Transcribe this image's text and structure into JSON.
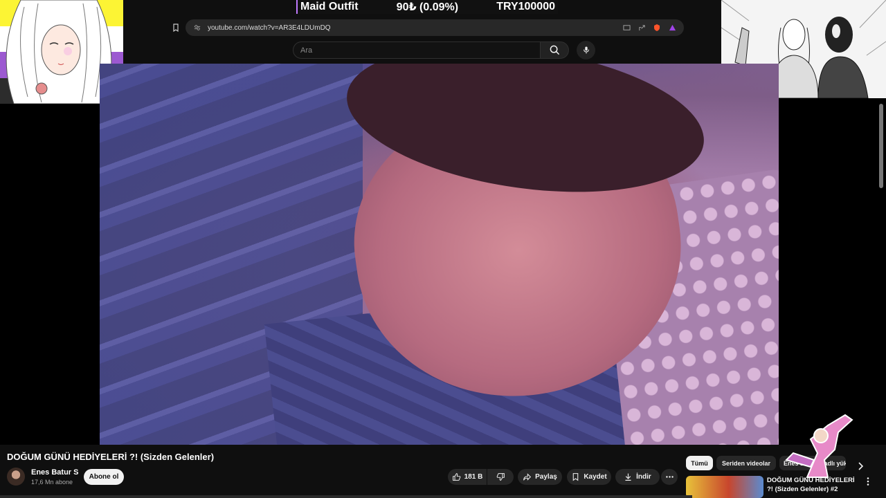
{
  "donation": {
    "item": "Maid Outfit",
    "amount": "90₺ (0.09%)",
    "goal": "TRY100000"
  },
  "browser": {
    "url": "youtube.com/watch?v=AR3E4LDUmDQ"
  },
  "youtube": {
    "search_placeholder": "Ara",
    "video_title": "DOĞUM GÜNÜ HEDİYELERİ ?! (Sizden Gelenler)",
    "channel_name": "Enes Batur S",
    "subscriber_count": "17,6 Mn abone",
    "subscribe_label": "Abone ol",
    "like_count": "181 B",
    "share_label": "Paylaş",
    "save_label": "Kaydet",
    "download_label": "İndir",
    "chips": [
      "Tümü",
      "Seriden videolar",
      "Enes Batur S adlı yükleyiciden"
    ],
    "recommended": {
      "title": "DOĞUM GÜNÜ HEDİYELERİ ?! (Sizden Gelenler) #2"
    }
  },
  "colors": {
    "bg": "#0f0f0f",
    "pill": "#272727",
    "donation_accent": "#c07aff"
  }
}
